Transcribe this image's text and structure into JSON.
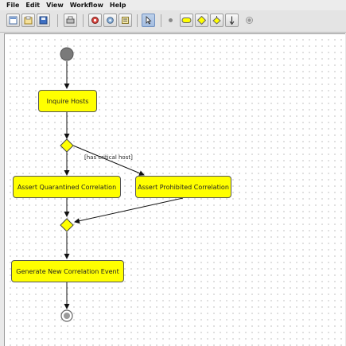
{
  "menu": [
    "File",
    "Edit",
    "View",
    "Workflow",
    "Help"
  ],
  "toolbar": {
    "buttons": [
      {
        "name": "new-workflow-icon"
      },
      {
        "name": "open-icon"
      },
      {
        "name": "save-icon"
      },
      {
        "name": "print-icon"
      },
      {
        "name": "validate-icon"
      },
      {
        "name": "settings-icon"
      },
      {
        "name": "properties-icon"
      },
      {
        "name": "select-pointer-icon",
        "pressed": true
      },
      {
        "name": "start-node-icon"
      },
      {
        "name": "activity-node-icon"
      },
      {
        "name": "decision-node-icon"
      },
      {
        "name": "merge-node-icon"
      },
      {
        "name": "transition-arrow-icon"
      },
      {
        "name": "end-node-icon"
      }
    ]
  },
  "workflow": {
    "nodes": {
      "inquire_hosts": "Inquire Hosts",
      "assert_quarantined": "Assert Quarantined Correlation",
      "assert_prohibited": "Assert Prohibited Correlation",
      "generate_event": "Generate New Correlation Event"
    },
    "guard_label": "[has critical host]"
  },
  "colors": {
    "activity_fill": "#ffff00",
    "start_node": "#7a7a7a",
    "canvas_bg": "#ffffff",
    "selected_tool": "#a4bde0"
  }
}
